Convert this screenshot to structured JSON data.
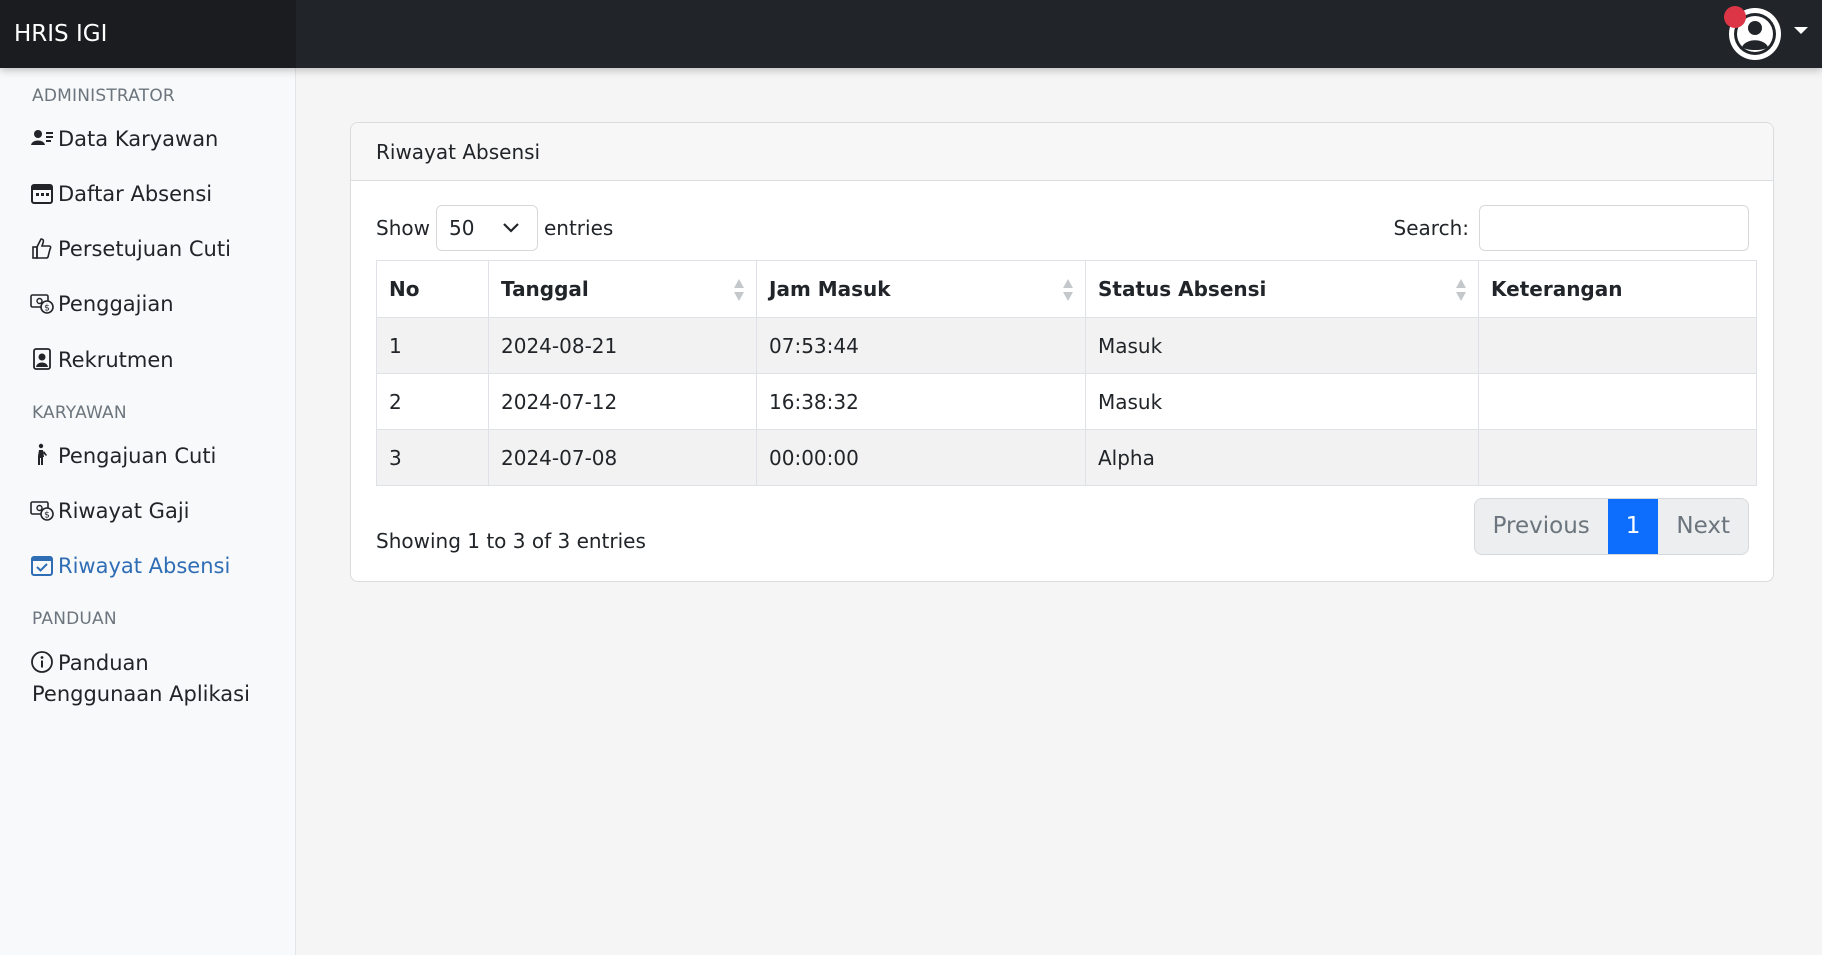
{
  "app": {
    "brand": "HRIS IGI"
  },
  "user_menu": {
    "notification_color": "#dc3545"
  },
  "sidebar": {
    "sections": [
      {
        "heading": "ADMINISTRATOR"
      },
      {
        "heading": "KARYAWAN"
      },
      {
        "heading": "PANDUAN"
      }
    ],
    "items": [
      {
        "label": "Data Karyawan",
        "icon": "user-list-icon"
      },
      {
        "label": "Daftar Absensi",
        "icon": "calendar-icon"
      },
      {
        "label": "Persetujuan Cuti",
        "icon": "thumbs-up-icon"
      },
      {
        "label": "Penggajian",
        "icon": "cash-icon"
      },
      {
        "label": "Rekrutmen",
        "icon": "person-badge-icon"
      },
      {
        "label": "Pengajuan Cuti",
        "icon": "person-walking-icon"
      },
      {
        "label": "Riwayat Gaji",
        "icon": "cash-icon"
      },
      {
        "label": "Riwayat Absensi",
        "icon": "calendar-check-icon",
        "active": true
      },
      {
        "label_line1": "Panduan",
        "label_line2": "Penggunaan Aplikasi",
        "icon": "info-circle-icon"
      }
    ],
    "active_color": "#2f6db5"
  },
  "card": {
    "title": "Riwayat Absensi",
    "length_menu": {
      "prefix": "Show",
      "selected": "50",
      "suffix": "entries"
    },
    "search": {
      "label": "Search:",
      "value": "",
      "placeholder": ""
    },
    "table": {
      "columns": [
        "No",
        "Tanggal",
        "Jam Masuk",
        "Status Absensi",
        "Keterangan"
      ],
      "rows": [
        [
          "1",
          "2024-08-21",
          "07:53:44",
          "Masuk",
          ""
        ],
        [
          "2",
          "2024-07-12",
          "16:38:32",
          "Masuk",
          ""
        ],
        [
          "3",
          "2024-07-08",
          "00:00:00",
          "Alpha",
          ""
        ]
      ]
    },
    "info": "Showing 1 to 3 of 3 entries",
    "pagination": {
      "previous": "Previous",
      "current": "1",
      "next": "Next"
    },
    "accent_color": "#0d6efd"
  }
}
